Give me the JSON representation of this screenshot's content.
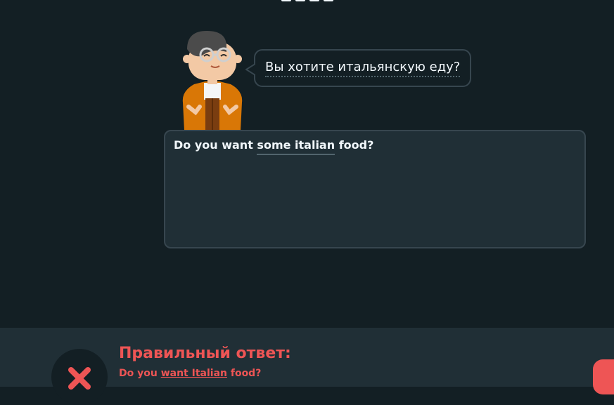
{
  "bubble": {
    "text": "Вы хотите итальянскую еду?"
  },
  "answer": {
    "before": "Do you want ",
    "highlight": "some italian",
    "after": " food?"
  },
  "feedback": {
    "title": "Правильный ответ:",
    "prefix": "Do you ",
    "highlight": "want Italian",
    "suffix": " food?"
  },
  "icons": {
    "status": "close-icon",
    "character": "character-avatar"
  },
  "colors": {
    "background": "#131f24",
    "panel": "#202f36",
    "error": "#ee5555",
    "border": "#37464f",
    "text": "#f1f7fb"
  }
}
